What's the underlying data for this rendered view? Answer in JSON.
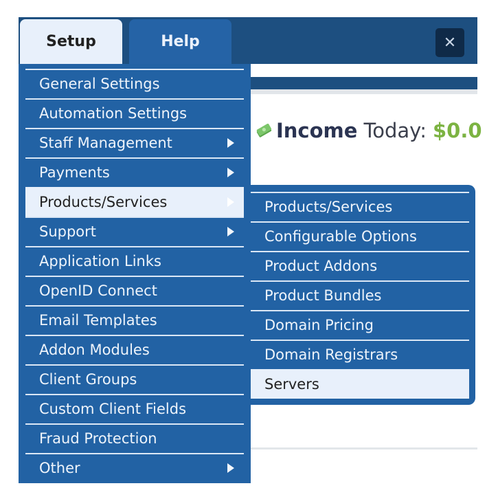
{
  "tabs": [
    {
      "label": "Setup",
      "active": true
    },
    {
      "label": "Help",
      "active": false
    }
  ],
  "close_button": {
    "icon": "close-icon",
    "glyph": "✕"
  },
  "income": {
    "icon": "money-icon",
    "label": "Income",
    "period": "Today:",
    "value": "$0.0"
  },
  "setup_menu": {
    "items": [
      {
        "label": "General Settings",
        "has_submenu": false
      },
      {
        "label": "Automation Settings",
        "has_submenu": false
      },
      {
        "label": "Staff Management",
        "has_submenu": true
      },
      {
        "label": "Payments",
        "has_submenu": true
      },
      {
        "label": "Products/Services",
        "has_submenu": true,
        "active": true
      },
      {
        "label": "Support",
        "has_submenu": true
      },
      {
        "label": "Application Links",
        "has_submenu": false
      },
      {
        "label": "OpenID Connect",
        "has_submenu": false
      },
      {
        "label": "Email Templates",
        "has_submenu": false
      },
      {
        "label": "Addon Modules",
        "has_submenu": false
      },
      {
        "label": "Client Groups",
        "has_submenu": false
      },
      {
        "label": "Custom Client Fields",
        "has_submenu": false
      },
      {
        "label": "Fraud Protection",
        "has_submenu": false
      },
      {
        "label": "Other",
        "has_submenu": true
      }
    ]
  },
  "products_submenu": {
    "items": [
      {
        "label": "Products/Services"
      },
      {
        "label": "Configurable Options"
      },
      {
        "label": "Product Addons"
      },
      {
        "label": "Product Bundles"
      },
      {
        "label": "Domain Pricing"
      },
      {
        "label": "Domain Registrars"
      },
      {
        "label": "Servers",
        "active": true
      }
    ]
  },
  "colors": {
    "nav_dark": "#1d4f80",
    "menu_blue": "#2262a4",
    "active_bg": "#e8f0fb",
    "income_green": "#7cb342"
  }
}
